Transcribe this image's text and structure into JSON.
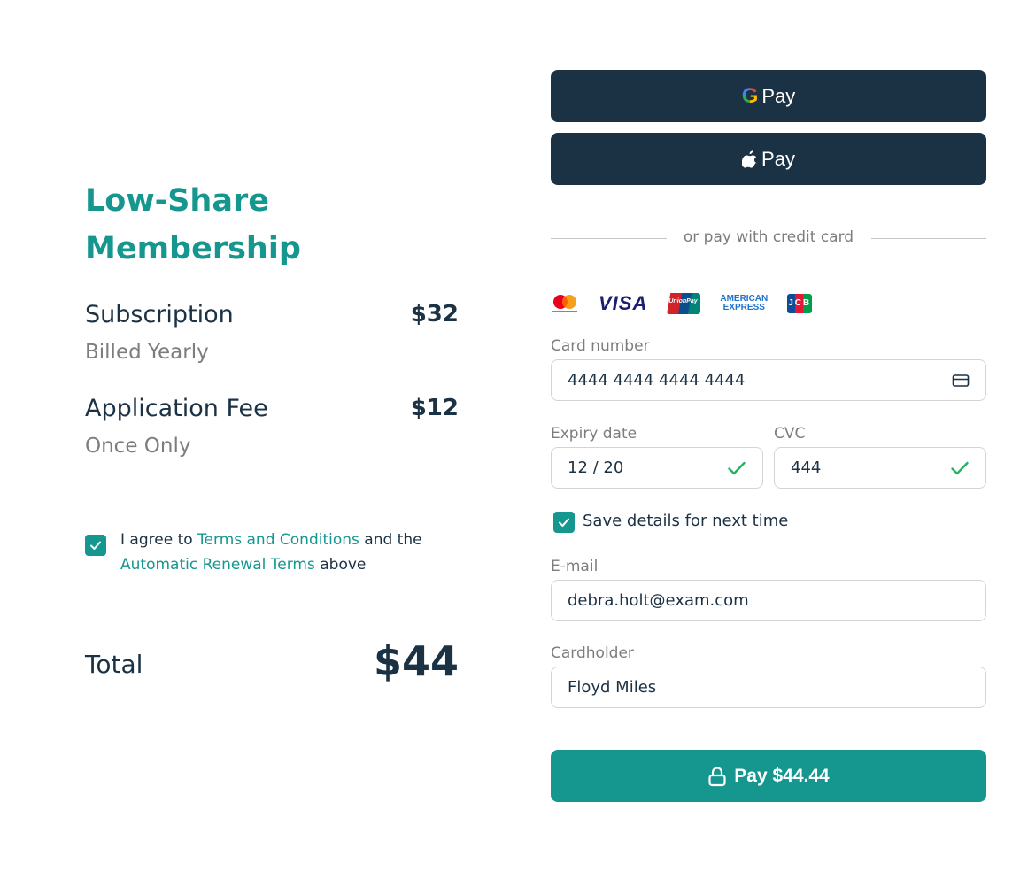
{
  "summary": {
    "title": "Low-Share Membership",
    "items": [
      {
        "label": "Subscription",
        "sublabel": "Billed Yearly",
        "price": "$32"
      },
      {
        "label": "Application Fee",
        "sublabel": "Once Only",
        "price": "$12"
      }
    ],
    "agreement": {
      "checked": true,
      "prefix": "I agree to ",
      "link1": "Terms and Conditions",
      "middle": " and the ",
      "link2": "Automatic Renewal Terms",
      "suffix": " above"
    },
    "total_label": "Total",
    "total_value": "$44"
  },
  "payment": {
    "google_pay_label": "Pay",
    "google_pay_g": "G",
    "apple_pay_label": "Pay",
    "divider_text": "or pay with credit card",
    "card_brands": {
      "visa": "VISA",
      "unionpay": "UnionPay",
      "amex_line1": "AMERICAN",
      "amex_line2": "EXPRESS",
      "jcb": "JCB"
    },
    "card_number": {
      "label": "Card number",
      "value": "4444 4444 4444 4444",
      "icon": "credit-card-icon"
    },
    "expiry": {
      "label": "Expiry date",
      "value": "12 / 20",
      "valid": true
    },
    "cvc": {
      "label": "CVC",
      "value": "444",
      "valid": true
    },
    "save_details": {
      "label": "Save details for next time",
      "checked": true
    },
    "email": {
      "label": "E-mail",
      "value": "debra.holt@exam.com"
    },
    "cardholder": {
      "label": "Cardholder",
      "value": "Floyd Miles"
    },
    "pay_button_label": "Pay $44.44"
  },
  "colors": {
    "accent": "#15968f",
    "navy": "#1b3144",
    "muted": "#7d7d7d",
    "valid_check": "#22b35e"
  }
}
